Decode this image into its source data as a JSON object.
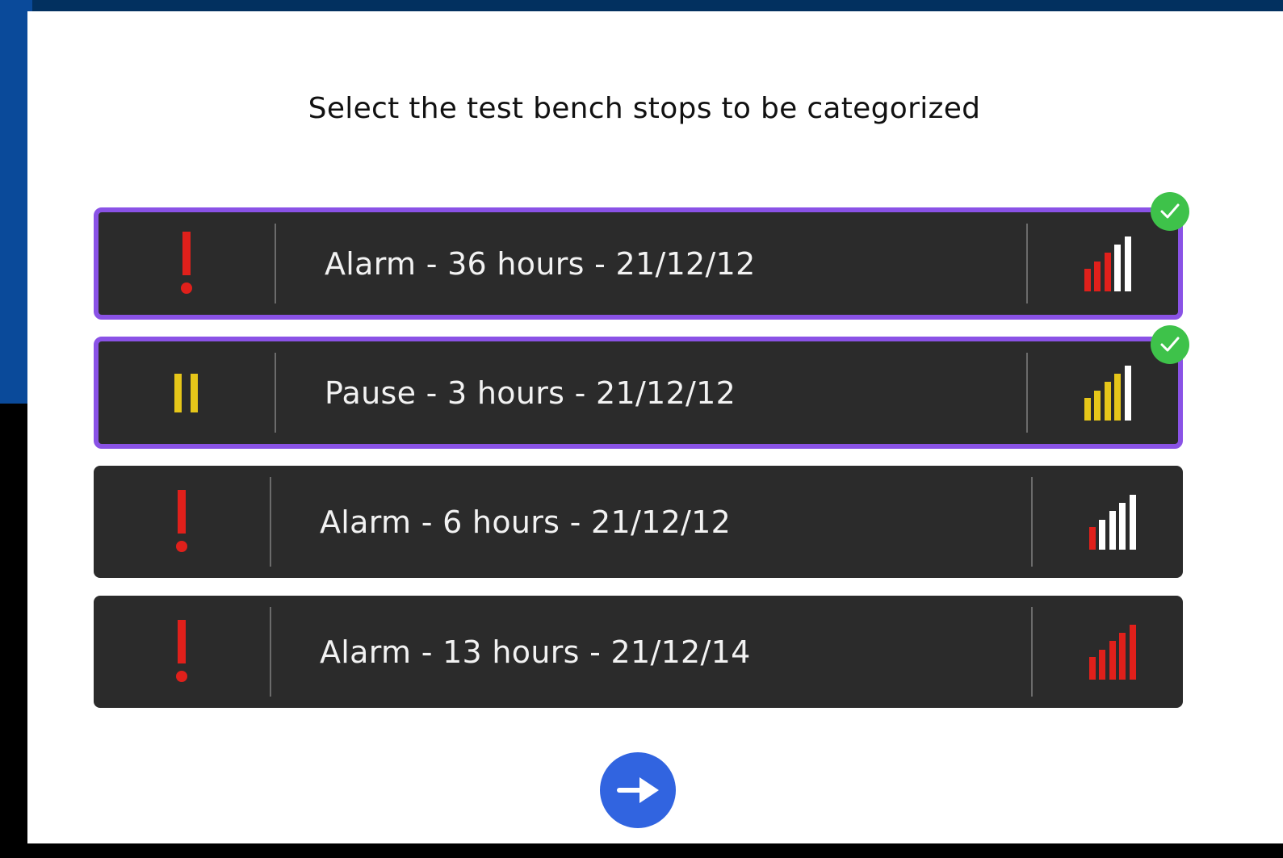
{
  "title": "Select the test bench stops to be categorized",
  "colors": {
    "alarm": "#e0201b",
    "pause": "#e6c619",
    "inactive_bar": "#ffffff",
    "selected_border": "#8a52e6",
    "check": "#3ec24a",
    "next_button": "#3164e0"
  },
  "stops": [
    {
      "label": "Alarm - 36 hours - 21/12/12",
      "type": "alarm",
      "status_icon": "exclamation-icon",
      "severity_level": 3,
      "selected": true
    },
    {
      "label": "Pause - 3 hours - 21/12/12",
      "type": "pause",
      "status_icon": "pause-icon",
      "severity_level": 4,
      "selected": true
    },
    {
      "label": "Alarm - 6 hours - 21/12/12",
      "type": "alarm",
      "status_icon": "exclamation-icon",
      "severity_level": 1,
      "selected": false
    },
    {
      "label": "Alarm - 13 hours - 21/12/14",
      "type": "alarm",
      "status_icon": "exclamation-icon",
      "severity_level": 5,
      "selected": false
    }
  ],
  "next_button": {
    "icon": "arrow-right-icon"
  }
}
